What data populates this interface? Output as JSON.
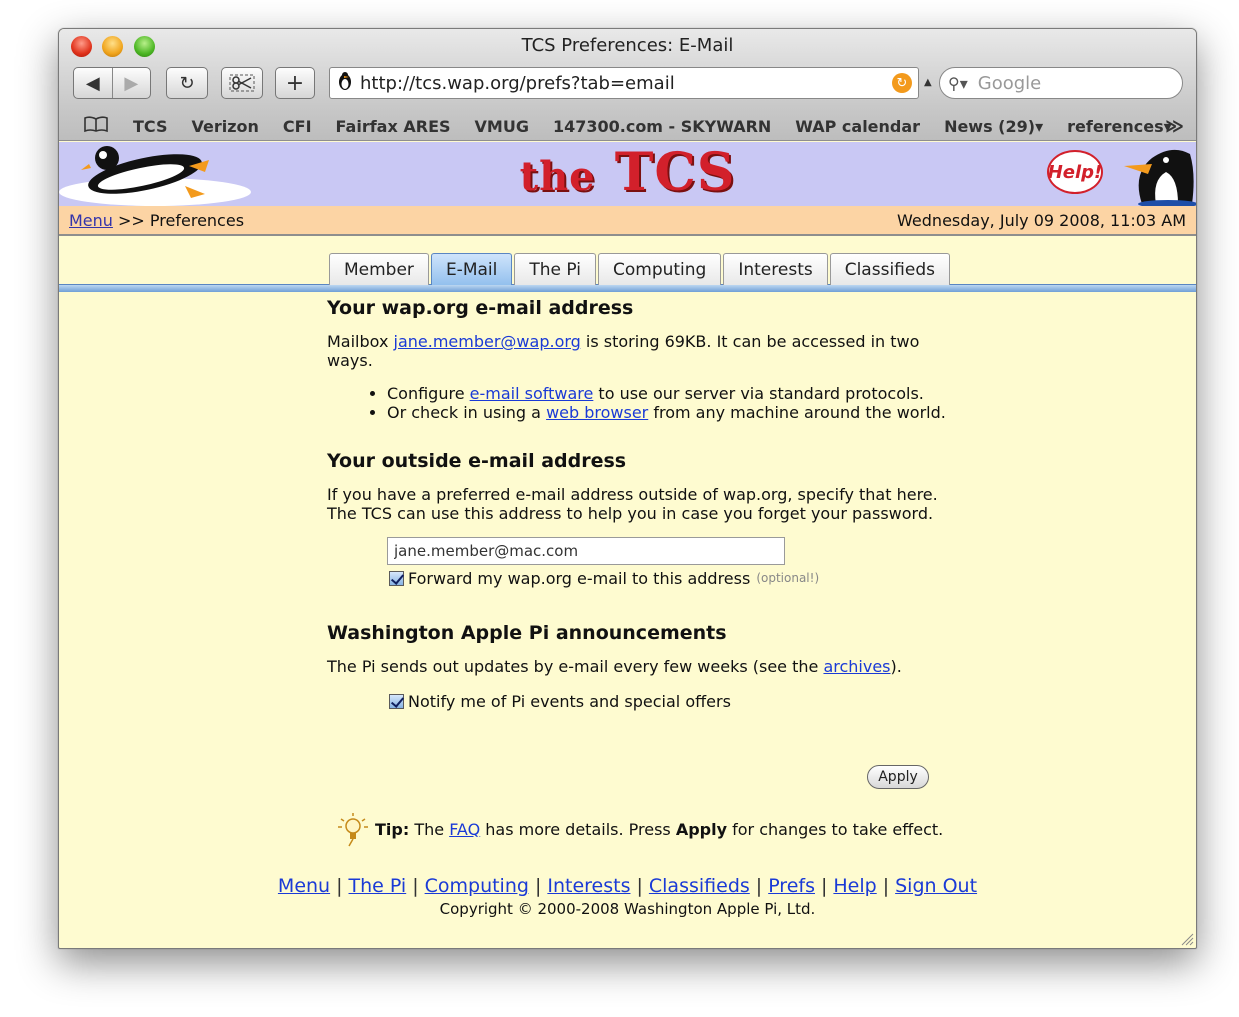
{
  "window": {
    "title": "TCS Preferences: E-Mail"
  },
  "toolbar": {
    "back_glyph": "◀",
    "forward_glyph": "▶",
    "reload_glyph": "↻",
    "add_glyph": "+",
    "url": "http://tcs.wap.org/prefs?tab=email",
    "search_placeholder": "Google"
  },
  "bookmarks": {
    "items": [
      "TCS",
      "Verizon",
      "CFI",
      "Fairfax ARES",
      "VMUG",
      "147300.com - SKYWARN",
      "WAP calendar",
      "News (29)▾",
      "references▾"
    ],
    "more_glyph": "≫"
  },
  "banner": {
    "logo_prefix": "the",
    "logo_main": "TCS",
    "help_label": "Help!"
  },
  "breadcrumb": {
    "menu_link": "Menu",
    "separator": " >> ",
    "current": "Preferences",
    "datetime": "Wednesday, July 09 2008, 11:03 AM"
  },
  "tabs": [
    {
      "label": "Member",
      "active": false
    },
    {
      "label": "E-Mail",
      "active": true
    },
    {
      "label": "The Pi",
      "active": false
    },
    {
      "label": "Computing",
      "active": false
    },
    {
      "label": "Interests",
      "active": false
    },
    {
      "label": "Classifieds",
      "active": false
    }
  ],
  "section_wap": {
    "heading": "Your wap.org e-mail address",
    "mailbox_prefix": "Mailbox ",
    "mailbox_address": "jane.member@wap.org",
    "mailbox_suffix": " is storing 69KB. It can be accessed in two ways.",
    "bullet1_prefix": "Configure ",
    "bullet1_link": "e-mail software",
    "bullet1_suffix": " to use our server via standard protocols.",
    "bullet2_prefix": "Or check in using a ",
    "bullet2_link": "web browser",
    "bullet2_suffix": " from any machine around the world."
  },
  "section_outside": {
    "heading": "Your outside e-mail address",
    "line1": "If you have a preferred e-mail address outside of wap.org, specify that here.",
    "line2": "The TCS can use this address to help you in case you forget your password.",
    "email_value": "jane.member@mac.com",
    "forward_label": "Forward my wap.org e-mail to this address",
    "optional_note": "(optional!)",
    "forward_checked": true
  },
  "section_pi": {
    "heading": "Washington Apple Pi announcements",
    "text_prefix": "The Pi sends out updates by e-mail every few weeks (see the ",
    "archives_link": "archives",
    "text_suffix": ").",
    "notify_label": "Notify me of Pi events and special offers",
    "notify_checked": true
  },
  "apply_label": "Apply",
  "tip": {
    "label": "Tip:",
    "prefix": " The ",
    "faq_link": "FAQ",
    "middle": " has more details. Press ",
    "apply_word": "Apply",
    "suffix": " for changes to take effect."
  },
  "footer": {
    "links": [
      "Menu",
      "The Pi",
      "Computing",
      "Interests",
      "Classifieds",
      "Prefs",
      "Help",
      "Sign Out"
    ],
    "copyright": "Copyright © 2000-2008 Washington Apple Pi, Ltd."
  }
}
